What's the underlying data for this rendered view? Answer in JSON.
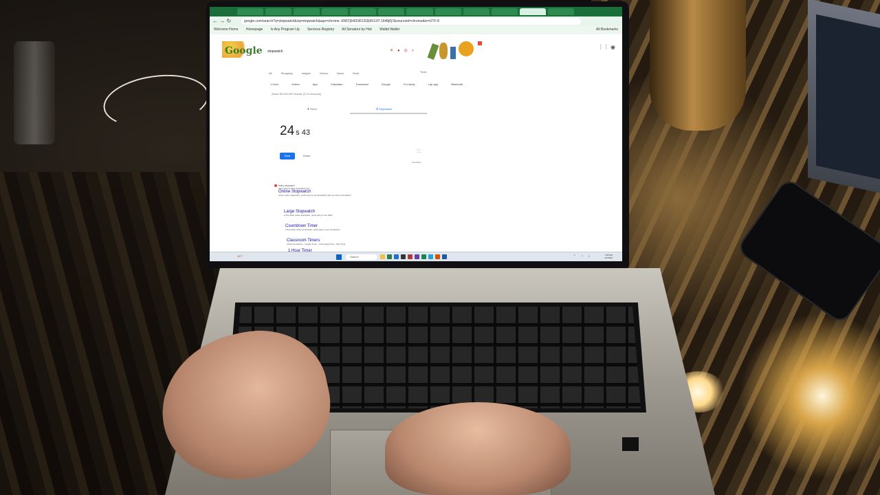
{
  "browser": {
    "url": "google.com/search?q=stopwatch&oq=stopwatch&aqs=chrome..69i57j0i433i512l2j0i512l7.1948j0j7&sourceid=chrome&ie=UTF-8",
    "bookmarks": [
      "Welcome Home",
      "Homepage",
      "Is Any Program Up",
      "Services Registry",
      "All Senators by Hist",
      "Wallet Wallet"
    ],
    "bookmarks_right": "All Bookmarks"
  },
  "google": {
    "logo": "Google",
    "query": "stopwatch",
    "tabs": [
      "All",
      "Shopping",
      "Images",
      "Videos",
      "News",
      "More"
    ],
    "tools": "Tools",
    "chips": [
      "1 Hour",
      "Online",
      "App",
      "Calculator",
      "Download",
      "Google",
      "For study",
      "Lap app",
      "Bluetooth"
    ],
    "result_count": "About 96,400,000 results (0.19 seconds)",
    "widget": {
      "tab_timer": "Timer",
      "tab_stopwatch": "Stopwatch",
      "time_main": "24",
      "time_sub": "s 43",
      "start_label": "Start",
      "reset_label": "Reset",
      "feedback": "Feedback"
    },
    "results": [
      {
        "site": "Online Stopwatch",
        "url": "https://www.online-stopwatch.com",
        "title": "Online Stopwatch",
        "snippet": "A free online stopwatch, quick easy to use stopwatch plus an online countdown!"
      },
      {
        "site": "",
        "url": "",
        "title": "Large Stopwatch",
        "snippet": "A free flash online stopwatch, quick easy to use flash!"
      },
      {
        "site": "",
        "url": "",
        "title": "Countdown Timer",
        "snippet": "A free flash online countdown, quick easy to use countdown"
      },
      {
        "site": "",
        "url": "",
        "title": "Classroom Timers",
        "snippet": "Clock Countdown - Candle Timer - Online Egg Timer - Bar Timer"
      },
      {
        "site": "",
        "url": "",
        "title": "1 Hour Timer",
        "snippet": ""
      }
    ]
  },
  "taskbar": {
    "weather": "38°F",
    "search": "Search",
    "clock_time": "4:55 PM",
    "clock_date": "2/1/2024"
  }
}
